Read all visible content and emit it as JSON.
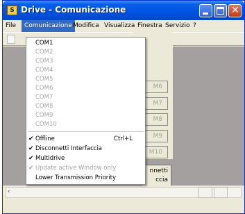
{
  "window": {
    "title": "Drive - Comunicazione",
    "app_icon": "app-icon"
  },
  "menubar": {
    "items": [
      "File",
      "Comunicazione",
      "Modifica",
      "Visualizza",
      "Finestra",
      "Servizio",
      "?"
    ],
    "active_index": 1
  },
  "toolbar": {
    "help_glyph": "?"
  },
  "panel": {
    "port_buttons": [
      "M6",
      "M7",
      "M8",
      "M9",
      "M10"
    ],
    "disconnect_button": [
      "nnetti",
      "ccia"
    ]
  },
  "dropdown": {
    "ports": [
      {
        "label": "COM1",
        "enabled": true
      },
      {
        "label": "COM2",
        "enabled": false
      },
      {
        "label": "COM3",
        "enabled": false
      },
      {
        "label": "COM4",
        "enabled": false
      },
      {
        "label": "COM5",
        "enabled": false
      },
      {
        "label": "COM6",
        "enabled": false
      },
      {
        "label": "COM7",
        "enabled": false
      },
      {
        "label": "COM8",
        "enabled": false
      },
      {
        "label": "COM9",
        "enabled": false
      },
      {
        "label": "COM10",
        "enabled": false
      }
    ],
    "options": [
      {
        "label": "Offline",
        "checked": true,
        "enabled": true,
        "shortcut": "Ctrl+L"
      },
      {
        "label": "Disconnetti Interfaccia",
        "checked": true,
        "enabled": true,
        "shortcut": ""
      },
      {
        "label": "Multidrive",
        "checked": true,
        "enabled": true,
        "shortcut": ""
      },
      {
        "label": "Update active Window only",
        "checked": true,
        "enabled": false,
        "shortcut": ""
      },
      {
        "label": "Lower Transmission Priority",
        "checked": false,
        "enabled": true,
        "shortcut": ""
      }
    ],
    "check_glyph": "✔"
  },
  "colors": {
    "titlebar": "#0054e3",
    "menu_highlight": "#316ac5",
    "client_bg": "#a4a0a0",
    "disabled_text": "#a7a7a7"
  }
}
